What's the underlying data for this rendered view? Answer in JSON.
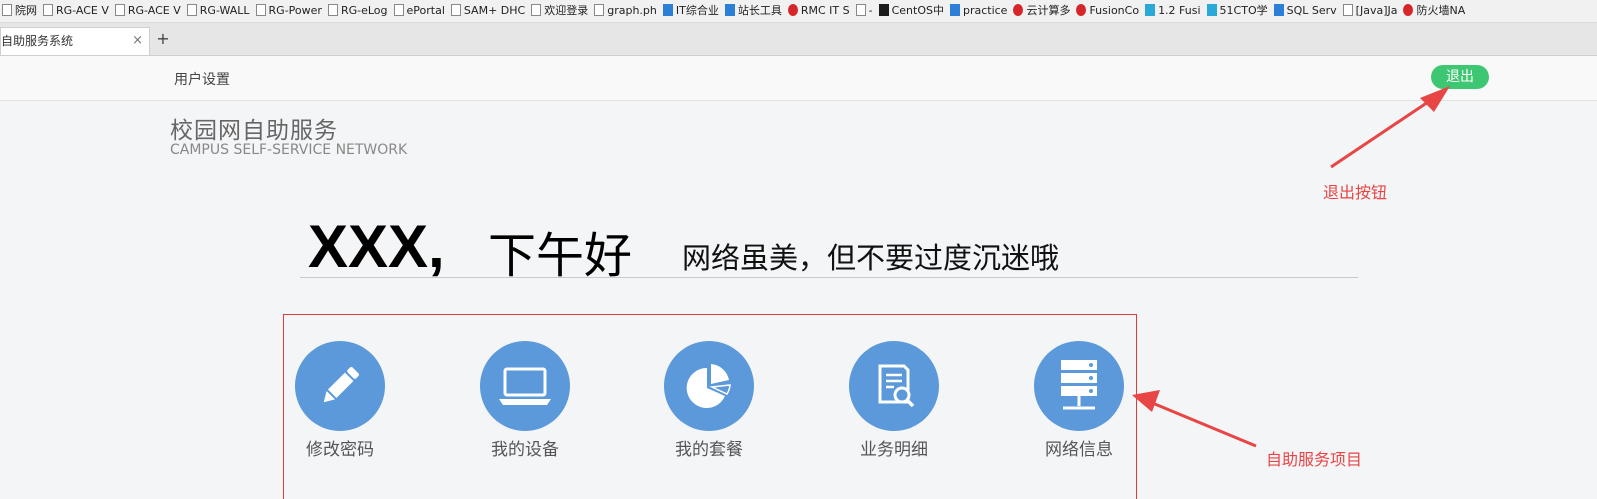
{
  "bookmarks": [
    {
      "label": "院网",
      "icon": "page-icon"
    },
    {
      "label": "RG-ACE V",
      "icon": "page-icon"
    },
    {
      "label": "RG-ACE V",
      "icon": "page-icon"
    },
    {
      "label": "RG-WALL",
      "icon": "page-icon"
    },
    {
      "label": "RG-Power",
      "icon": "page-icon"
    },
    {
      "label": "RG-eLog",
      "icon": "page-icon"
    },
    {
      "label": "ePortal",
      "icon": "page-icon"
    },
    {
      "label": "SAM+ DHC",
      "icon": "page-icon"
    },
    {
      "label": "欢迎登录",
      "icon": "page-icon"
    },
    {
      "label": "graph.ph",
      "icon": "page-icon"
    },
    {
      "label": "IT综合业",
      "icon": "site-icon"
    },
    {
      "label": "站长工具",
      "icon": "site-icon"
    },
    {
      "label": "RMC IT S",
      "icon": "red-icon"
    },
    {
      "label": "-",
      "icon": "page-icon"
    },
    {
      "label": "CentOS中",
      "icon": "terminal-icon"
    },
    {
      "label": "practice",
      "icon": "site-icon"
    },
    {
      "label": "云计算多",
      "icon": "red-icon"
    },
    {
      "label": "FusionCo",
      "icon": "red-icon"
    },
    {
      "label": "1.2 Fusi",
      "icon": "cyan-icon"
    },
    {
      "label": "51CTO学",
      "icon": "cyan-icon"
    },
    {
      "label": "SQL Serv",
      "icon": "site-icon"
    },
    {
      "label": "[Java]Ja",
      "icon": "page-icon"
    },
    {
      "label": "防火墙NA",
      "icon": "red-icon"
    }
  ],
  "tab": {
    "title": "自助服务系统",
    "close": "×",
    "new_tab": "+"
  },
  "header": {
    "user_settings": "用户设置",
    "logout": "退出"
  },
  "logo": {
    "cn": "校园网自助服务",
    "en": "CAMPUS  SELF-SERVICE NETWORK"
  },
  "greeting": {
    "name": "XXX,",
    "time_greeting": "下午好",
    "motto": "网络虽美，但不要过度沉迷哦"
  },
  "services": [
    {
      "label": "修改密码",
      "icon": "pencil-icon"
    },
    {
      "label": "我的设备",
      "icon": "laptop-icon"
    },
    {
      "label": "我的套餐",
      "icon": "pie-chart-icon"
    },
    {
      "label": "业务明细",
      "icon": "document-search-icon"
    },
    {
      "label": "网络信息",
      "icon": "server-icon"
    }
  ],
  "annotations": {
    "logout_note": "退出按钮",
    "services_note": "自助服务项目"
  },
  "colors": {
    "logout_green": "#3ec772",
    "icon_blue": "#5b99da",
    "annotation_red": "#e84545"
  }
}
